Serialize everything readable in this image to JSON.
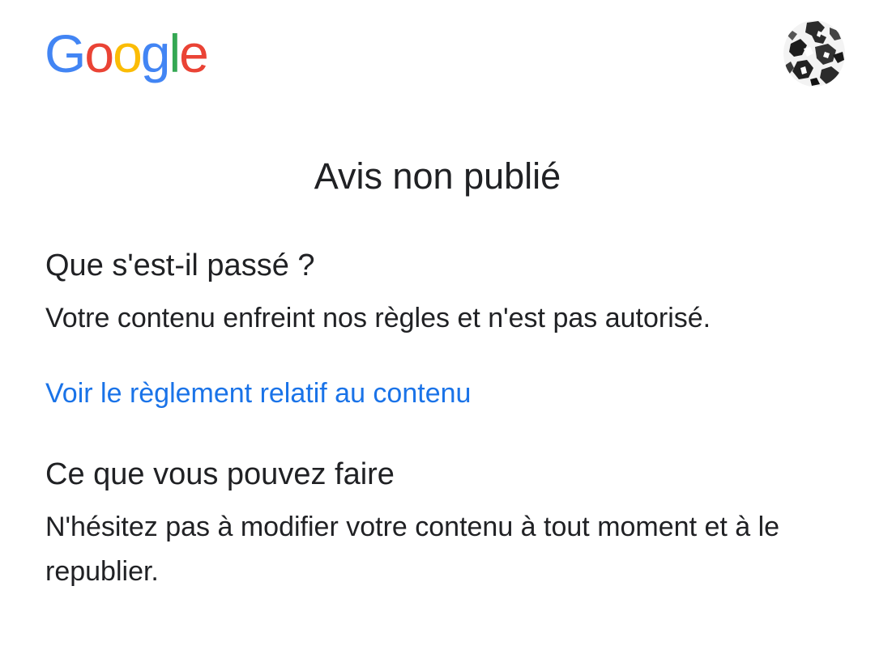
{
  "header": {
    "logo_letters": [
      "G",
      "o",
      "o",
      "g",
      "l",
      "e"
    ],
    "logo_colors": [
      "#4285F4",
      "#EA4335",
      "#FBBC05",
      "#4285F4",
      "#34A853",
      "#EA4335"
    ],
    "avatar_icon": "account-avatar-icon"
  },
  "main": {
    "title": "Avis non publié",
    "what_happened": {
      "heading": "Que s'est-il passé ?",
      "text": "Votre contenu enfreint nos règles et n'est pas autorisé."
    },
    "policy_link": {
      "label": "Voir le règlement relatif au contenu",
      "color": "#1a73e8"
    },
    "what_you_can_do": {
      "heading": "Ce que vous pouvez faire",
      "text": "N'hésitez pas à modifier votre contenu à tout moment et à le republier."
    }
  }
}
